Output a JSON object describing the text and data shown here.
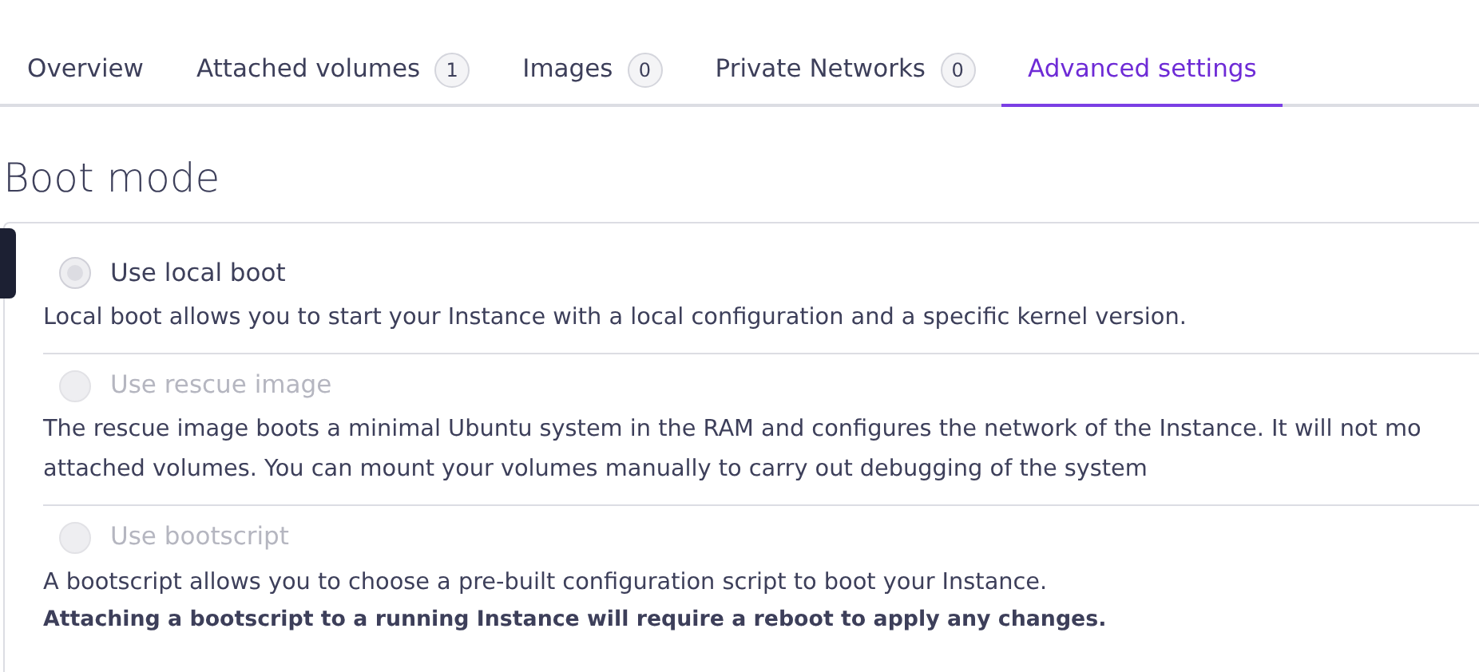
{
  "tabs": [
    {
      "label": "Overview",
      "selected": false
    },
    {
      "label": "Attached volumes",
      "count": "1",
      "selected": false
    },
    {
      "label": "Images",
      "count": "0",
      "selected": false
    },
    {
      "label": "Private Networks",
      "count": "0",
      "selected": false
    },
    {
      "label": "Advanced settings",
      "selected": true
    }
  ],
  "section_title": "Boot mode",
  "boot_options": [
    {
      "label": "Use local boot",
      "selected": true,
      "disabled": false,
      "description": [
        "Local boot allows you to start your Instance with a local configuration and a specific kernel version."
      ]
    },
    {
      "label": "Use rescue image",
      "selected": false,
      "disabled": true,
      "description": [
        "The rescue image boots a minimal Ubuntu system in the RAM and configures the network of the Instance. It will not mo",
        "attached volumes. You can mount your volumes manually to carry out debugging of the system"
      ]
    },
    {
      "label": "Use bootscript",
      "selected": false,
      "disabled": true,
      "description": [
        "A bootscript allows you to choose a pre-built configuration script to boot your Instance."
      ],
      "warning": "Attaching a bootscript to a running Instance will require a reboot to apply any changes."
    }
  ]
}
